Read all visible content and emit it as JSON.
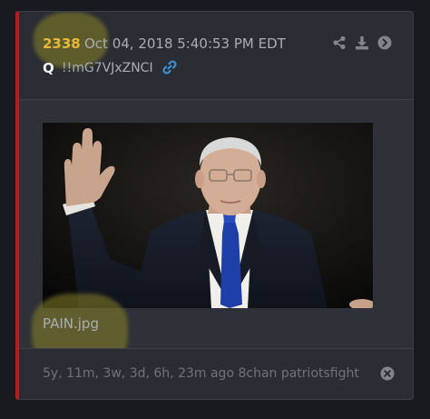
{
  "post": {
    "number": "2338",
    "date": "Oct 04, 2018 5:40:53 PM EDT",
    "author": "Q",
    "tripcode": "!!mG7VJxZNCI",
    "filename": "PAIN.jpg",
    "footer": "5y, 11m, 3w, 3d, 6h, 23m ago 8chan patriotsfight"
  },
  "icons": {
    "link": "link-icon",
    "share": "share-icon",
    "download": "download-icon",
    "navigate": "arrow-circle-right-icon",
    "close": "close-circle-icon"
  },
  "colors": {
    "accent_border": "#b71c1c",
    "post_number": "#e8b83a",
    "link": "#3d8fd6",
    "highlight": "#8b8426"
  }
}
